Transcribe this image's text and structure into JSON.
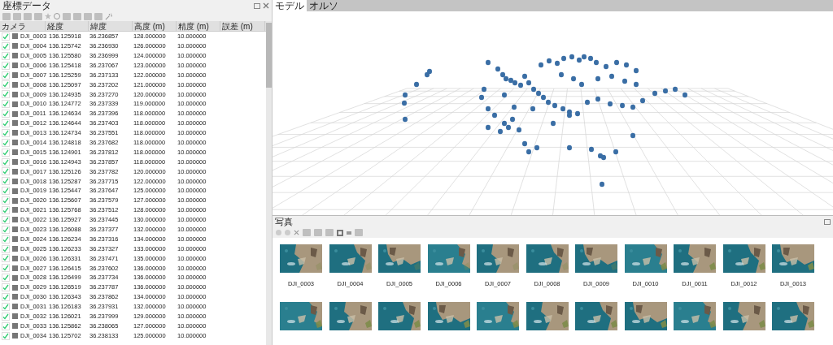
{
  "reference_panel": {
    "title": "座標データ",
    "columns": [
      "カメラ",
      "経度",
      "緯度",
      "高度 (m)",
      "精度 (m)",
      "誤差 (m)"
    ],
    "rows": [
      {
        "checked": true,
        "camera": "DJI_0003",
        "longitude": "136.125918",
        "latitude": "36.236857",
        "altitude": "128.000000",
        "accuracy": "10.000000"
      },
      {
        "checked": true,
        "camera": "DJI_0004",
        "longitude": "136.125742",
        "latitude": "36.236930",
        "altitude": "126.000000",
        "accuracy": "10.000000"
      },
      {
        "checked": true,
        "camera": "DJI_0005",
        "longitude": "136.125580",
        "latitude": "36.236999",
        "altitude": "124.000000",
        "accuracy": "10.000000"
      },
      {
        "checked": true,
        "camera": "DJI_0006",
        "longitude": "136.125418",
        "latitude": "36.237067",
        "altitude": "123.000000",
        "accuracy": "10.000000"
      },
      {
        "checked": true,
        "camera": "DJI_0007",
        "longitude": "136.125259",
        "latitude": "36.237133",
        "altitude": "122.000000",
        "accuracy": "10.000000"
      },
      {
        "checked": true,
        "camera": "DJI_0008",
        "longitude": "136.125097",
        "latitude": "36.237202",
        "altitude": "121.000000",
        "accuracy": "10.000000"
      },
      {
        "checked": true,
        "camera": "DJI_0009",
        "longitude": "136.124935",
        "latitude": "36.237270",
        "altitude": "120.000000",
        "accuracy": "10.000000"
      },
      {
        "checked": true,
        "camera": "DJI_0010",
        "longitude": "136.124772",
        "latitude": "36.237339",
        "altitude": "119.000000",
        "accuracy": "10.000000"
      },
      {
        "checked": true,
        "camera": "DJI_0011",
        "longitude": "136.124634",
        "latitude": "36.237396",
        "altitude": "118.000000",
        "accuracy": "10.000000"
      },
      {
        "checked": true,
        "camera": "DJI_0012",
        "longitude": "136.124644",
        "latitude": "36.237403",
        "altitude": "118.000000",
        "accuracy": "10.000000"
      },
      {
        "checked": true,
        "camera": "DJI_0013",
        "longitude": "136.124734",
        "latitude": "36.237551",
        "altitude": "118.000000",
        "accuracy": "10.000000"
      },
      {
        "checked": true,
        "camera": "DJI_0014",
        "longitude": "136.124818",
        "latitude": "36.237682",
        "altitude": "118.000000",
        "accuracy": "10.000000"
      },
      {
        "checked": true,
        "camera": "DJI_0015",
        "longitude": "136.124901",
        "latitude": "36.237812",
        "altitude": "118.000000",
        "accuracy": "10.000000"
      },
      {
        "checked": true,
        "camera": "DJI_0016",
        "longitude": "136.124943",
        "latitude": "36.237857",
        "altitude": "118.000000",
        "accuracy": "10.000000"
      },
      {
        "checked": true,
        "camera": "DJI_0017",
        "longitude": "136.125126",
        "latitude": "36.237782",
        "altitude": "120.000000",
        "accuracy": "10.000000"
      },
      {
        "checked": true,
        "camera": "DJI_0018",
        "longitude": "136.125287",
        "latitude": "36.237715",
        "altitude": "122.000000",
        "accuracy": "10.000000"
      },
      {
        "checked": true,
        "camera": "DJI_0019",
        "longitude": "136.125447",
        "latitude": "36.237647",
        "altitude": "125.000000",
        "accuracy": "10.000000"
      },
      {
        "checked": true,
        "camera": "DJI_0020",
        "longitude": "136.125607",
        "latitude": "36.237579",
        "altitude": "127.000000",
        "accuracy": "10.000000"
      },
      {
        "checked": true,
        "camera": "DJI_0021",
        "longitude": "136.125768",
        "latitude": "36.237512",
        "altitude": "128.000000",
        "accuracy": "10.000000"
      },
      {
        "checked": true,
        "camera": "DJI_0022",
        "longitude": "136.125927",
        "latitude": "36.237445",
        "altitude": "130.000000",
        "accuracy": "10.000000"
      },
      {
        "checked": true,
        "camera": "DJI_0023",
        "longitude": "136.126088",
        "latitude": "36.237377",
        "altitude": "132.000000",
        "accuracy": "10.000000"
      },
      {
        "checked": true,
        "camera": "DJI_0024",
        "longitude": "136.126234",
        "latitude": "36.237316",
        "altitude": "134.000000",
        "accuracy": "10.000000"
      },
      {
        "checked": true,
        "camera": "DJI_0025",
        "longitude": "136.126233",
        "latitude": "36.237327",
        "altitude": "133.000000",
        "accuracy": "10.000000"
      },
      {
        "checked": true,
        "camera": "DJI_0026",
        "longitude": "136.126331",
        "latitude": "36.237471",
        "altitude": "135.000000",
        "accuracy": "10.000000"
      },
      {
        "checked": true,
        "camera": "DJI_0027",
        "longitude": "136.126415",
        "latitude": "36.237602",
        "altitude": "136.000000",
        "accuracy": "10.000000"
      },
      {
        "checked": true,
        "camera": "DJI_0028",
        "longitude": "136.126499",
        "latitude": "36.237734",
        "altitude": "136.000000",
        "accuracy": "10.000000"
      },
      {
        "checked": true,
        "camera": "DJI_0029",
        "longitude": "136.126519",
        "latitude": "36.237787",
        "altitude": "136.000000",
        "accuracy": "10.000000"
      },
      {
        "checked": true,
        "camera": "DJI_0030",
        "longitude": "136.126343",
        "latitude": "36.237862",
        "altitude": "134.000000",
        "accuracy": "10.000000"
      },
      {
        "checked": true,
        "camera": "DJI_0031",
        "longitude": "136.126183",
        "latitude": "36.237931",
        "altitude": "132.000000",
        "accuracy": "10.000000"
      },
      {
        "checked": true,
        "camera": "DJI_0032",
        "longitude": "136.126021",
        "latitude": "36.237999",
        "altitude": "129.000000",
        "accuracy": "10.000000"
      },
      {
        "checked": true,
        "camera": "DJI_0033",
        "longitude": "136.125862",
        "latitude": "36.238065",
        "altitude": "127.000000",
        "accuracy": "10.000000"
      },
      {
        "checked": true,
        "camera": "DJI_0034",
        "longitude": "136.125702",
        "latitude": "36.238133",
        "altitude": "125.000000",
        "accuracy": "10.000000"
      }
    ]
  },
  "view_tabs": [
    {
      "label": "モデル",
      "selected": true
    },
    {
      "label": "オルソ",
      "selected": false
    }
  ],
  "photos_panel": {
    "title": "写真",
    "photos": [
      {
        "label": "DJI_0003"
      },
      {
        "label": "DJI_0004"
      },
      {
        "label": "DJI_0005"
      },
      {
        "label": "DJI_0006"
      },
      {
        "label": "DJI_0007"
      },
      {
        "label": "DJI_0008"
      },
      {
        "label": "DJI_0009"
      },
      {
        "label": "DJI_0010"
      },
      {
        "label": "DJI_0011"
      },
      {
        "label": "DJI_0012"
      },
      {
        "label": "DJI_0013"
      }
    ]
  }
}
